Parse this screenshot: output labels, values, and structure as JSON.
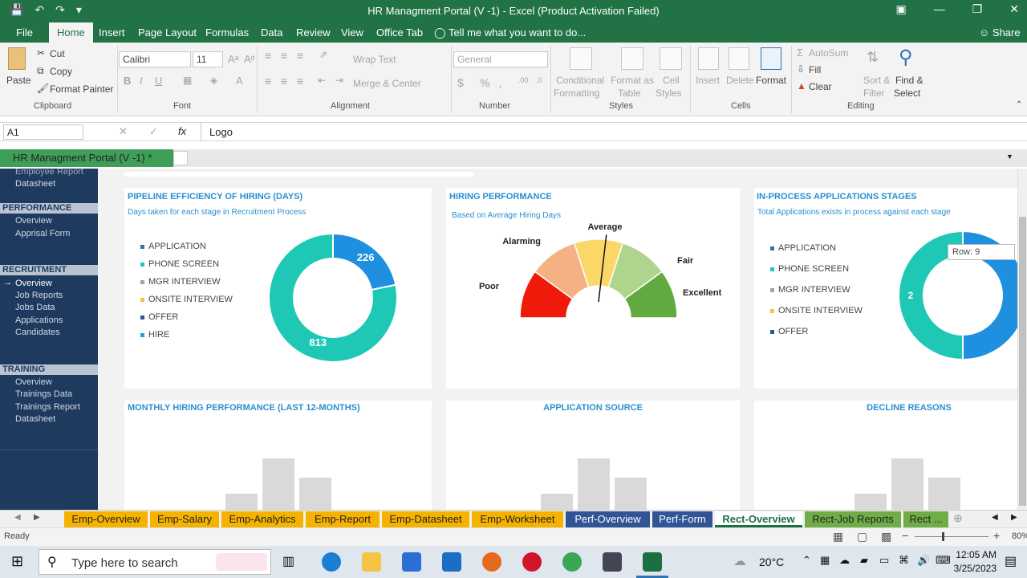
{
  "window": {
    "title": "HR Managment Portal (V -1) - Excel (Product Activation Failed)"
  },
  "ribbon_tabs": [
    "File",
    "Home",
    "Insert",
    "Page Layout",
    "Formulas",
    "Data",
    "Review",
    "View",
    "Office Tab"
  ],
  "tell_me": "Tell me what you want to do...",
  "share": "Share",
  "clipboard": {
    "paste": "Paste",
    "cut": "Cut",
    "copy": "Copy",
    "format_painter": "Format Painter",
    "label": "Clipboard"
  },
  "font": {
    "name": "Calibri",
    "size": "11",
    "label": "Font"
  },
  "alignment": {
    "wrap": "Wrap Text",
    "merge": "Merge & Center",
    "label": "Alignment"
  },
  "number": {
    "format": "General",
    "label": "Number"
  },
  "styles": {
    "conditional": [
      "Conditional",
      "Formatting"
    ],
    "format_table": [
      "Format as",
      "Table"
    ],
    "cell_styles": [
      "Cell",
      "Styles"
    ],
    "label": "Styles"
  },
  "cells": {
    "insert": "Insert",
    "delete": "Delete",
    "format": "Format",
    "label": "Cells"
  },
  "editing": {
    "autosum": "AutoSum",
    "fill": "Fill",
    "clear": "Clear",
    "sort": [
      "Sort &",
      "Filter"
    ],
    "find": [
      "Find &",
      "Select"
    ],
    "label": "Editing"
  },
  "formula": {
    "namebox": "A1",
    "fx": "fx",
    "content": "Logo"
  },
  "workbook_tab": "HR Managment Portal (V -1) *",
  "sidebar": {
    "top_items": [
      "Employee Report",
      "Datasheet"
    ],
    "performance": {
      "head": "PERFORMANCE",
      "items": [
        "Overview",
        "Apprisal Form"
      ]
    },
    "recruitment": {
      "head": "RECRUITMENT",
      "items": [
        "Overview",
        "Job Reports",
        "Jobs Data",
        "Applications",
        "Candidates"
      ]
    },
    "training": {
      "head": "TRAINING",
      "items": [
        "Overview",
        "Trainings Data",
        "Trainings Report",
        "Datasheet"
      ]
    }
  },
  "card1": {
    "title": "PIPELINE EFFICIENCY OF HIRING (DAYS)",
    "subtitle": "Days taken for each stage in Recruitment Process",
    "legend": [
      "APPLICATION",
      "PHONE SCREEN",
      "MGR INTERVIEW",
      "ONSITE INTERVIEW",
      "OFFER",
      "HIRE"
    ],
    "colors": [
      "#2e75b6",
      "#1fc8b5",
      "#a5a5a5",
      "#f5c342",
      "#2f5597",
      "#26a0e0"
    ]
  },
  "chart_data": [
    {
      "type": "pie",
      "title": "PIPELINE EFFICIENCY OF HIRING (DAYS)",
      "labels": [
        "HIRE",
        "PHONE SCREEN"
      ],
      "values": [
        226,
        813
      ],
      "colors": [
        "#1f8fe0",
        "#1fc8b5"
      ]
    },
    {
      "type": "pie",
      "title": "IN-PROCESS APPLICATIONS STAGES",
      "labels": [
        "PHONE SCREEN",
        "APPLICATION"
      ],
      "values": [
        2,
        2
      ],
      "colors": [
        "#1fc8b5",
        "#1f8fe0"
      ]
    }
  ],
  "card2": {
    "title": "HIRING PERFORMANCE",
    "subtitle": "Based on Average Hiring Days",
    "gauge": [
      "Poor",
      "Alarming",
      "Average",
      "Fair",
      "Excellent"
    ],
    "gauge_colors": [
      "#f01a0a",
      "#f5b183",
      "#fad766",
      "#aed48e",
      "#62a93f"
    ],
    "needle_fraction": 0.53
  },
  "card3": {
    "title": "IN-PROCESS APPLICATIONS STAGES",
    "subtitle": "Total Applications exists in process against each stage",
    "legend": [
      "APPLICATION",
      "PHONE SCREEN",
      "MGR INTERVIEW",
      "ONSITE INTERVIEW",
      "OFFER"
    ],
    "colors": [
      "#2e75b6",
      "#1fc8b5",
      "#a5a5a5",
      "#f5c342",
      "#2f5597"
    ],
    "tooltip": "Row: 9",
    "left_value": "2",
    "right_value": "2"
  },
  "bottom_titles": [
    "MONTHLY HIRING PERFORMANCE (LAST 12-MONTHS)",
    "APPLICATION SOURCE",
    "DECLINE REASONS"
  ],
  "sheet_tabs": [
    {
      "label": "Emp-Overview",
      "color": "#f5b300"
    },
    {
      "label": "Emp-Salary",
      "color": "#f5b300"
    },
    {
      "label": "Emp-Analytics",
      "color": "#f5b300"
    },
    {
      "label": "Emp-Report",
      "color": "#f5b300"
    },
    {
      "label": "Emp-Datasheet",
      "color": "#f5b300"
    },
    {
      "label": "Emp-Worksheet",
      "color": "#f5b300"
    },
    {
      "label": "Perf-Overview",
      "color": "#2f5597"
    },
    {
      "label": "Perf-Form",
      "color": "#2f5597"
    },
    {
      "label": "Rect-Overview",
      "color": "#ffffff"
    },
    {
      "label": "Rect-Job Reports",
      "color": "#70ad47"
    },
    {
      "label": "Rect ...",
      "color": "#70ad47"
    }
  ],
  "status": {
    "ready": "Ready",
    "zoom": "80%"
  },
  "taskbar": {
    "search": "Type here to search",
    "temp": "20°C",
    "time": "12:05 AM",
    "date": "3/25/2023"
  }
}
